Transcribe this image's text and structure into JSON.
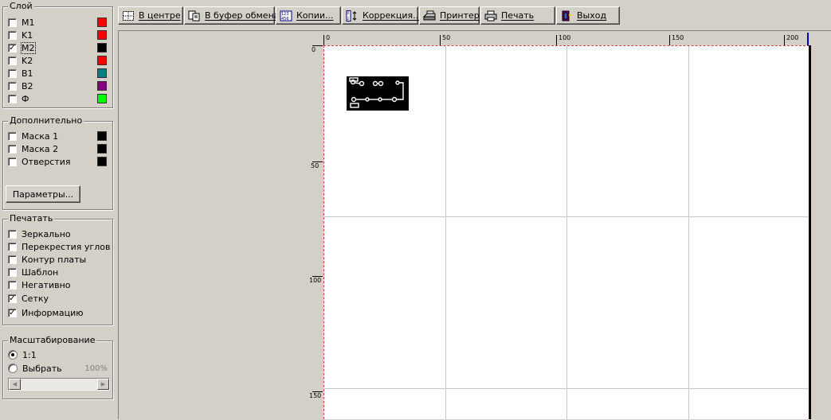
{
  "layers": {
    "title": "Слой",
    "items": [
      {
        "label": "M1",
        "checked": false,
        "color": "#ff0000"
      },
      {
        "label": "K1",
        "checked": false,
        "color": "#ff0000"
      },
      {
        "label": "M2",
        "checked": true,
        "color": "#000000"
      },
      {
        "label": "K2",
        "checked": false,
        "color": "#ff0000"
      },
      {
        "label": "B1",
        "checked": false,
        "color": "#008080"
      },
      {
        "label": "B2",
        "checked": false,
        "color": "#800080"
      },
      {
        "label": "Ф",
        "checked": false,
        "color": "#00ff00"
      }
    ]
  },
  "extra": {
    "title": "Дополнительно",
    "items": [
      {
        "label": "Маска 1",
        "checked": false,
        "color": "#000000"
      },
      {
        "label": "Маска 2",
        "checked": false,
        "color": "#000000"
      },
      {
        "label": "Отверстия",
        "checked": false,
        "color": "#000000"
      }
    ],
    "params_button": "Параметры..."
  },
  "print": {
    "title": "Печатать",
    "items": [
      {
        "label": "Зеркально",
        "checked": false
      },
      {
        "label": "Перекрестия углов",
        "checked": false
      },
      {
        "label": "Контур платы",
        "checked": false
      },
      {
        "label": "Шаблон",
        "checked": false
      },
      {
        "label": "Негативно",
        "checked": false
      },
      {
        "label": "Сетку",
        "checked": true
      },
      {
        "label": "Информацию",
        "checked": true
      }
    ]
  },
  "scale": {
    "title": "Масштабирование",
    "option_1to1": "1:1",
    "option_choose": "Выбрать",
    "selected": "1:1",
    "percent": "100%"
  },
  "toolbar": {
    "center": "В центре",
    "clipboard": "В буфер обмена",
    "copies": "Копии...",
    "correction": "Коррекция...",
    "printer": "Принтер",
    "print": "Печать",
    "exit": "Выход"
  },
  "ruler": {
    "top_labels": [
      "0",
      "50",
      "100",
      "150",
      "200"
    ],
    "left_labels": [
      "0",
      "50",
      "100",
      "150"
    ]
  },
  "colors": {
    "page_border": "#d04040",
    "grid": "#c8c8c8",
    "window_bg": "#d4d0c8"
  }
}
